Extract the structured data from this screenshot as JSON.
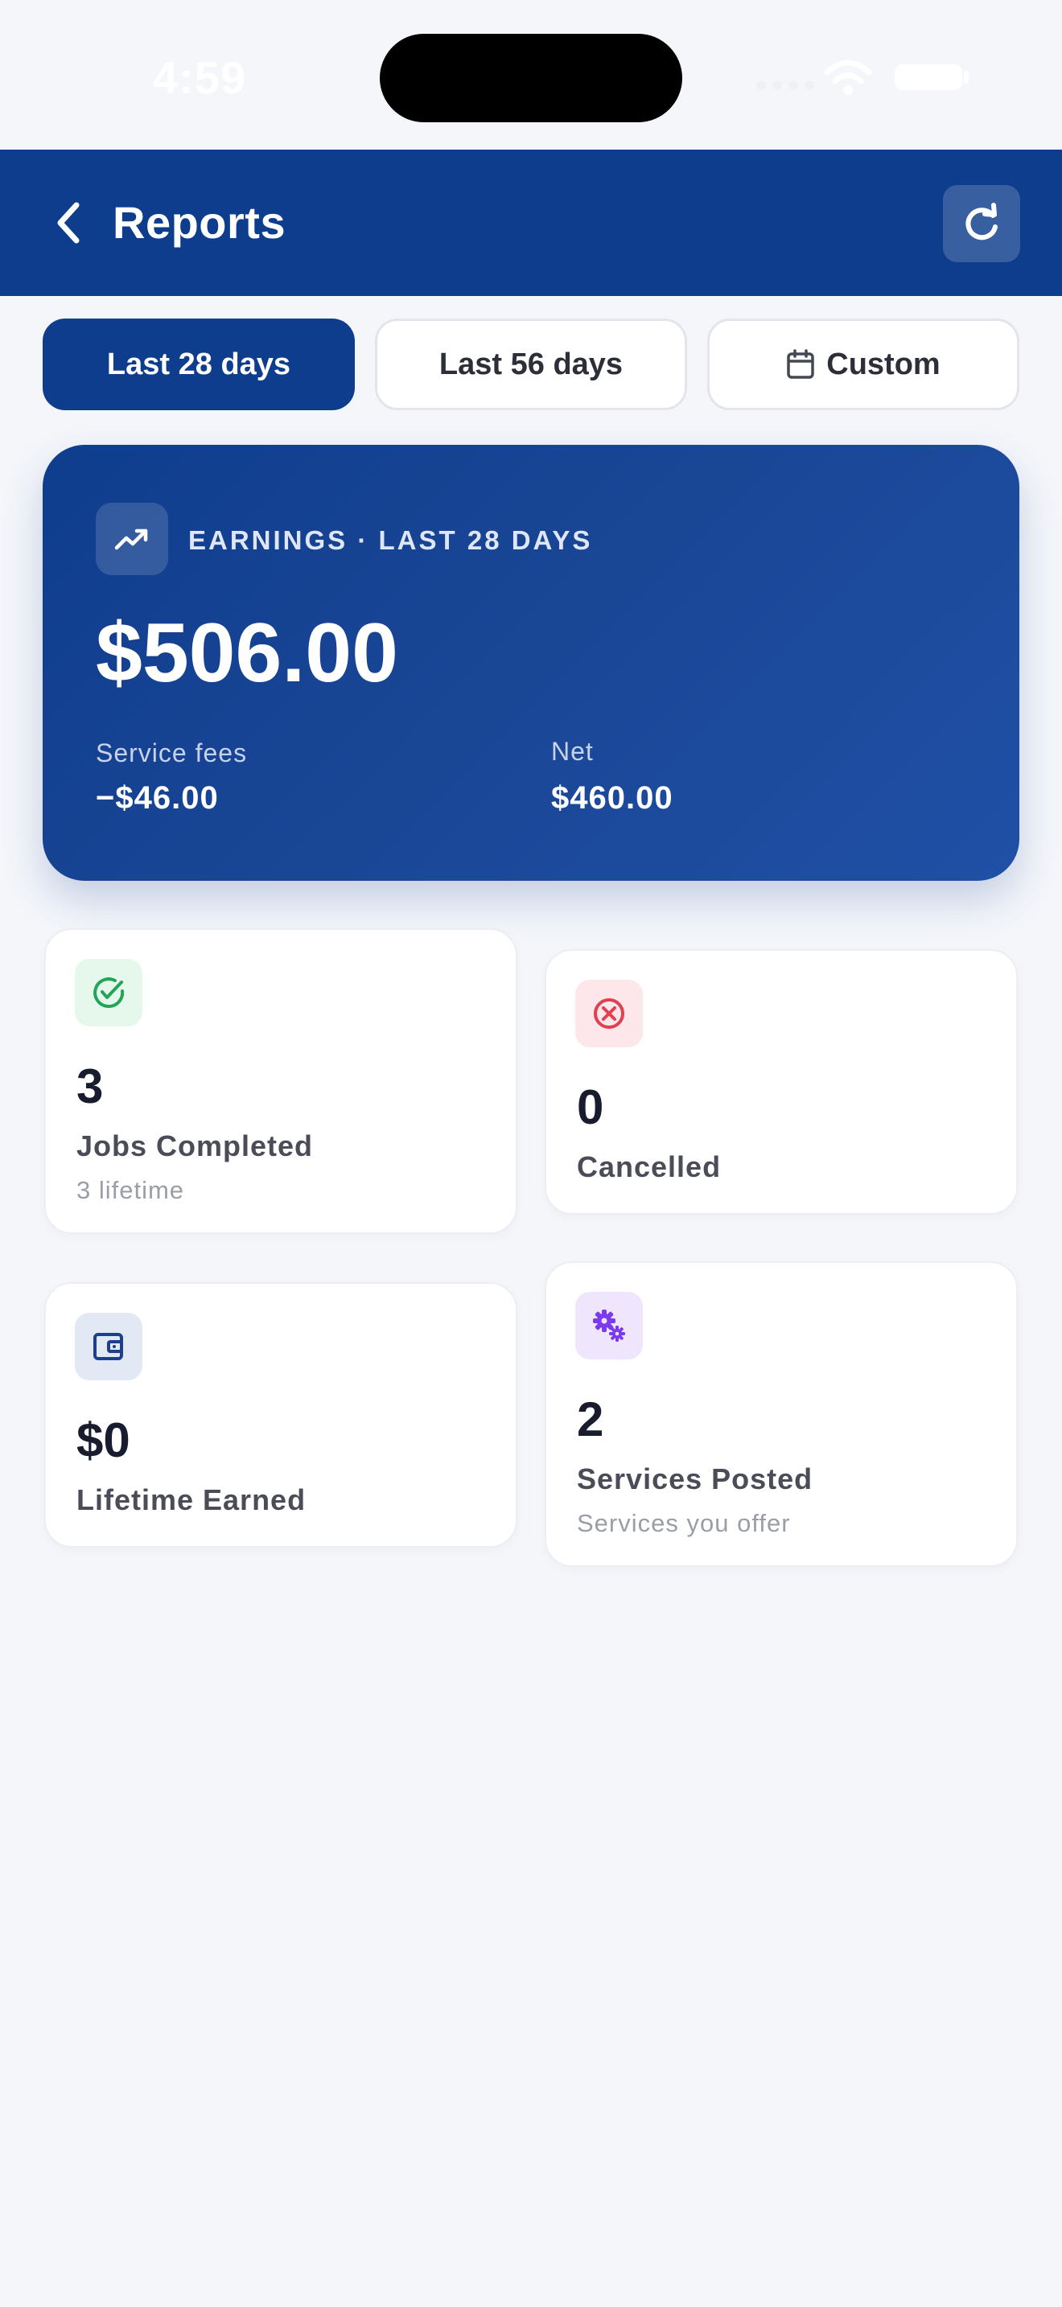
{
  "status_bar": {
    "time": "4:59"
  },
  "header": {
    "title": "Reports",
    "back_icon": "chevron-left-icon",
    "refresh_icon": "refresh-icon",
    "color": "#0d3d8c"
  },
  "range_tabs": [
    {
      "label": "Last 28 days",
      "active": true
    },
    {
      "label": "Last 56 days",
      "active": false
    },
    {
      "label": "Custom",
      "active": false,
      "icon": "calendar-icon"
    }
  ],
  "earnings": {
    "icon": "trending-up-icon",
    "label": "EARNINGS · LAST 28 DAYS",
    "amount": "$506.00",
    "fees_label": "Service fees",
    "fees_value": "−$46.00",
    "net_label": "Net",
    "net_value": "$460.00"
  },
  "stats": {
    "jobs_completed": {
      "icon": "check-circle-icon",
      "value": "3",
      "label": "Jobs Completed",
      "sub": "3 lifetime",
      "accent": "#22a559"
    },
    "cancelled": {
      "icon": "x-circle-icon",
      "value": "0",
      "label": "Cancelled",
      "accent": "#e0404f"
    },
    "lifetime_earned": {
      "icon": "wallet-icon",
      "value": "$0",
      "label": "Lifetime Earned",
      "accent": "#1e3f8a"
    },
    "services_posted": {
      "icon": "gears-icon",
      "value": "2",
      "label": "Services Posted",
      "sub": "Services you offer",
      "accent": "#7c3aed"
    }
  }
}
